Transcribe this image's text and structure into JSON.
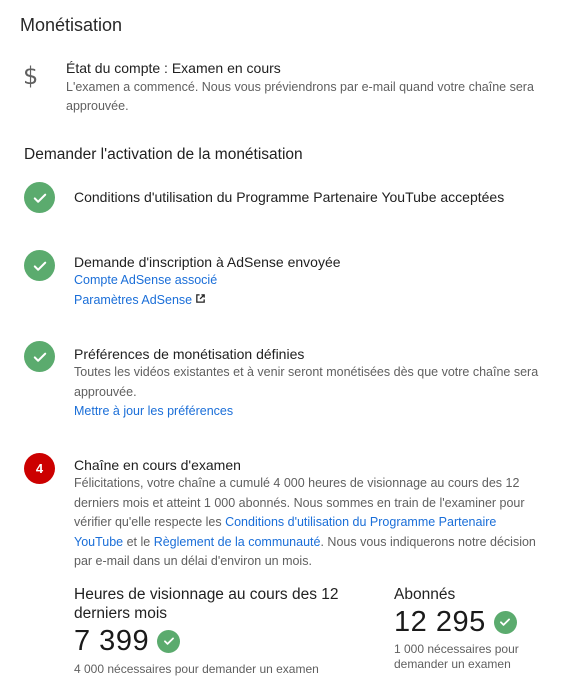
{
  "title": "Monétisation",
  "account": {
    "icon": "dollar-icon",
    "status": "État du compte : Examen en cours",
    "description": "L'examen a commencé. Nous vous préviendrons par e-mail quand votre chaîne sera approuvée."
  },
  "section_title": "Demander l'activation de la monétisation",
  "steps": [
    {
      "icon": "check-icon",
      "title": "Conditions d'utilisation du Programme Partenaire YouTube acceptées"
    },
    {
      "icon": "check-icon",
      "title": "Demande d'inscription à AdSense envoyée",
      "links": [
        "Compte AdSense associé",
        "Paramètres AdSense"
      ]
    },
    {
      "icon": "check-icon",
      "title": "Préférences de monétisation définies",
      "description": "Toutes les vidéos existantes et à venir seront monétisées dès que votre chaîne sera approuvée.",
      "links": [
        "Mettre à jour les préférences"
      ]
    },
    {
      "icon": "step-number",
      "number": "4",
      "title": "Chaîne en cours d'examen",
      "description_parts": {
        "p1": "Félicitations, votre chaîne a cumulé 4 000 heures de visionnage au cours des 12 derniers mois et atteint 1 000 abonnés. Nous sommes en train de l'examiner pour vérifier qu'elle respecte les ",
        "link1": "Conditions d'utilisation du Programme Partenaire YouTube",
        "p2": " et le ",
        "link2": "Règlement de la communauté",
        "p3": ". Nous vous indiquerons notre décision par e-mail dans un délai d'environ un mois."
      }
    }
  ],
  "stats": [
    {
      "label": "Heures de visionnage au cours des 12 derniers mois",
      "value": "7 399",
      "note": "4 000 nécessaires pour demander un examen"
    },
    {
      "label": "Abonnés",
      "value": "12 295",
      "note": "1 000 nécessaires pour demander un examen"
    }
  ],
  "colors": {
    "check": "#5bab6e",
    "pending": "#cc0000",
    "link": "#1a6ed8"
  }
}
